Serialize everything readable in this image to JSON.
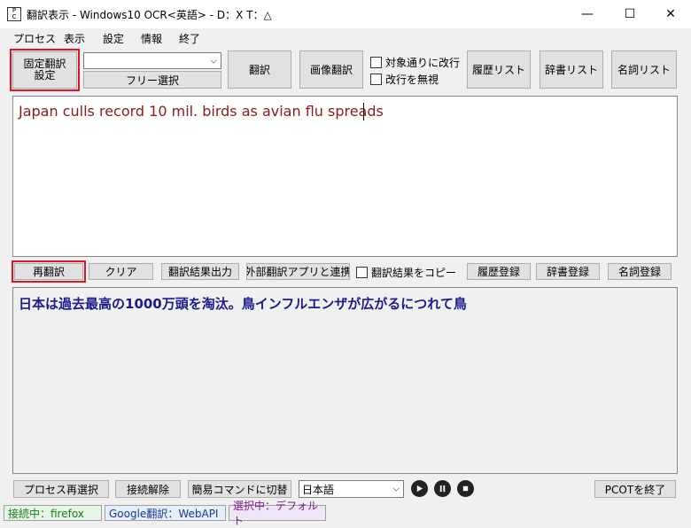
{
  "window": {
    "title": "翻訳表示 - Windows10 OCR<英語> - D：X T：△",
    "app_icon": "pcot-app-icon",
    "controls": {
      "minimize": "—",
      "maximize": "☐",
      "close": "✕"
    }
  },
  "menu": [
    "プロセス",
    "表示",
    "設定",
    "情報",
    "終了"
  ],
  "toolbar": {
    "fixed_translation_setting": "固定翻訳\n設定",
    "engine_select_value": "",
    "free_select": "フリー選択",
    "translate": "翻訳",
    "image_translate": "画像翻訳",
    "checkbox_linebreak_by_target": "対象通りに改行",
    "checkbox_ignore_linebreak": "改行を無視",
    "history_list": "履歴リスト",
    "dictionary_list": "辞書リスト",
    "noun_list": "名詞リスト"
  },
  "source_text": "Japan culls record 10 mil. birds as avian flu spreads",
  "middle_bar": {
    "retranslate": "再翻訳",
    "clear": "クリア",
    "export_result": "翻訳結果出力",
    "external_app_link": "外部翻訳アプリと連携",
    "checkbox_copy_result": "翻訳結果をコピー",
    "history_register": "履歴登録",
    "dictionary_register": "辞書登録",
    "noun_register": "名詞登録"
  },
  "translated_text": "日本は過去最高の1000万頭を淘汰。鳥インフルエンザが広がるにつれて鳥",
  "bottom_bar": {
    "process_reselect": "プロセス再選択",
    "disconnect": "接続解除",
    "simple_command_switch": "簡易コマンドに切替",
    "language_select_value": "日本語",
    "exit_pcot": "PCOTを終了"
  },
  "status": {
    "connected": "接続中：firefox",
    "engine": "Google翻訳：WebAPI",
    "selection": "選択中：デフォルト"
  },
  "colors": {
    "highlight_outline": "#e81123",
    "source_text": "#8b1a1a",
    "translated_text": "#1a1a8c",
    "status_connected_bg": "#e6f5e6",
    "status_engine_bg": "#e6eefa",
    "status_selection_bg": "#efe6f5"
  }
}
